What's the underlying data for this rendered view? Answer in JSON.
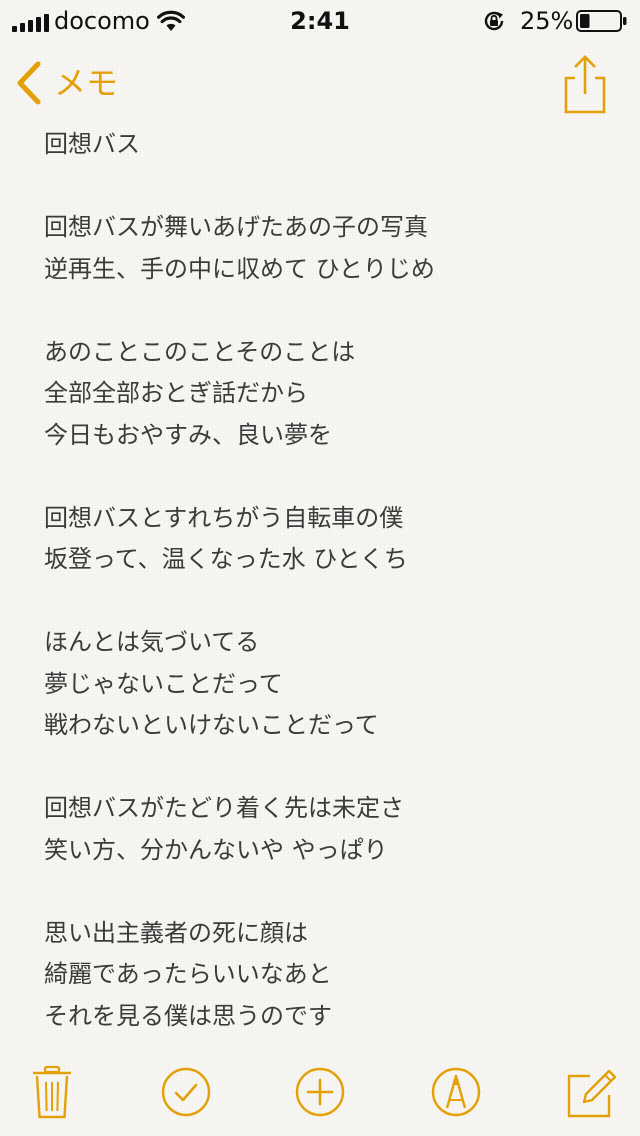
{
  "status_bar": {
    "carrier": "docomo",
    "time": "2:41",
    "battery_percent": "25%",
    "battery_level": 0.25,
    "icons": [
      "signal-icon",
      "wifi-icon",
      "rotation-lock-icon",
      "battery-icon"
    ]
  },
  "nav": {
    "back_label": "メモ",
    "icons": [
      "chevron-left-icon",
      "share-icon"
    ]
  },
  "note": {
    "lines": [
      "回想バス",
      "",
      "回想バスが舞いあげたあの子の写真",
      "逆再生、手の中に収めて ひとりじめ",
      "",
      "あのことこのことそのことは",
      "全部全部おとぎ話だから",
      "今日もおやすみ、良い夢を",
      "",
      "回想バスとすれちがう自転車の僕",
      "坂登って、温くなった水 ひとくち",
      "",
      "ほんとは気づいてる",
      "夢じゃないことだって",
      "戦わないといけないことだって",
      "",
      "回想バスがたどり着く先は未定さ",
      "笑い方、分かんないや やっぱり",
      "",
      "思い出主義者の死に顔は",
      "綺麗であったらいいなあと",
      "それを見る僕は思うのです"
    ]
  },
  "toolbar": {
    "icons": [
      "trash-icon",
      "checklist-icon",
      "add-icon",
      "sketch-icon",
      "compose-icon"
    ]
  },
  "colors": {
    "accent": "#e3a008",
    "text": "#3b3b3b",
    "background": "#f7f6f2"
  }
}
